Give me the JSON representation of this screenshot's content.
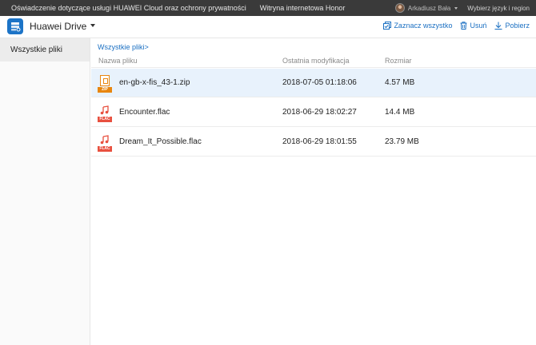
{
  "topbar": {
    "privacy_link": "Oświadczenie dotyczące usługi HUAWEI Cloud oraz ochrony prywatności",
    "honor_link": "Witryna internetowa Honor",
    "user_name": "Arkadiusz Bała",
    "language_region": "Wybierz język i region"
  },
  "header": {
    "app_name": "Huawei Drive",
    "actions": {
      "select_all": "Zaznacz wszystko",
      "delete": "Usuń",
      "download": "Pobierz"
    }
  },
  "sidebar": {
    "items": [
      {
        "label": "Wszystkie pliki"
      }
    ]
  },
  "main": {
    "breadcrumb": "Wszystkie pliki>",
    "columns": {
      "name": "Nazwa pliku",
      "modified": "Ostatnia modyfikacja",
      "size": "Rozmiar"
    },
    "files": [
      {
        "name": "en-gb-x-fis_43-1.zip",
        "modified": "2018-07-05 01:18:06",
        "size": "4.57 MB",
        "type_label": "ZIP",
        "icon": "zip-file-icon"
      },
      {
        "name": "Encounter.flac",
        "modified": "2018-06-29 18:02:27",
        "size": "14.4 MB",
        "type_label": "FLAC",
        "icon": "audio-file-icon"
      },
      {
        "name": "Dream_It_Possible.flac",
        "modified": "2018-06-29 18:01:55",
        "size": "23.79 MB",
        "type_label": "FLAC",
        "icon": "audio-file-icon"
      }
    ]
  },
  "colors": {
    "accent": "#1a6fc2",
    "topbar_bg": "#3a3a3a",
    "selected_row": "#e8f2fc",
    "zip": "#e8860f",
    "flac": "#e8503f"
  }
}
